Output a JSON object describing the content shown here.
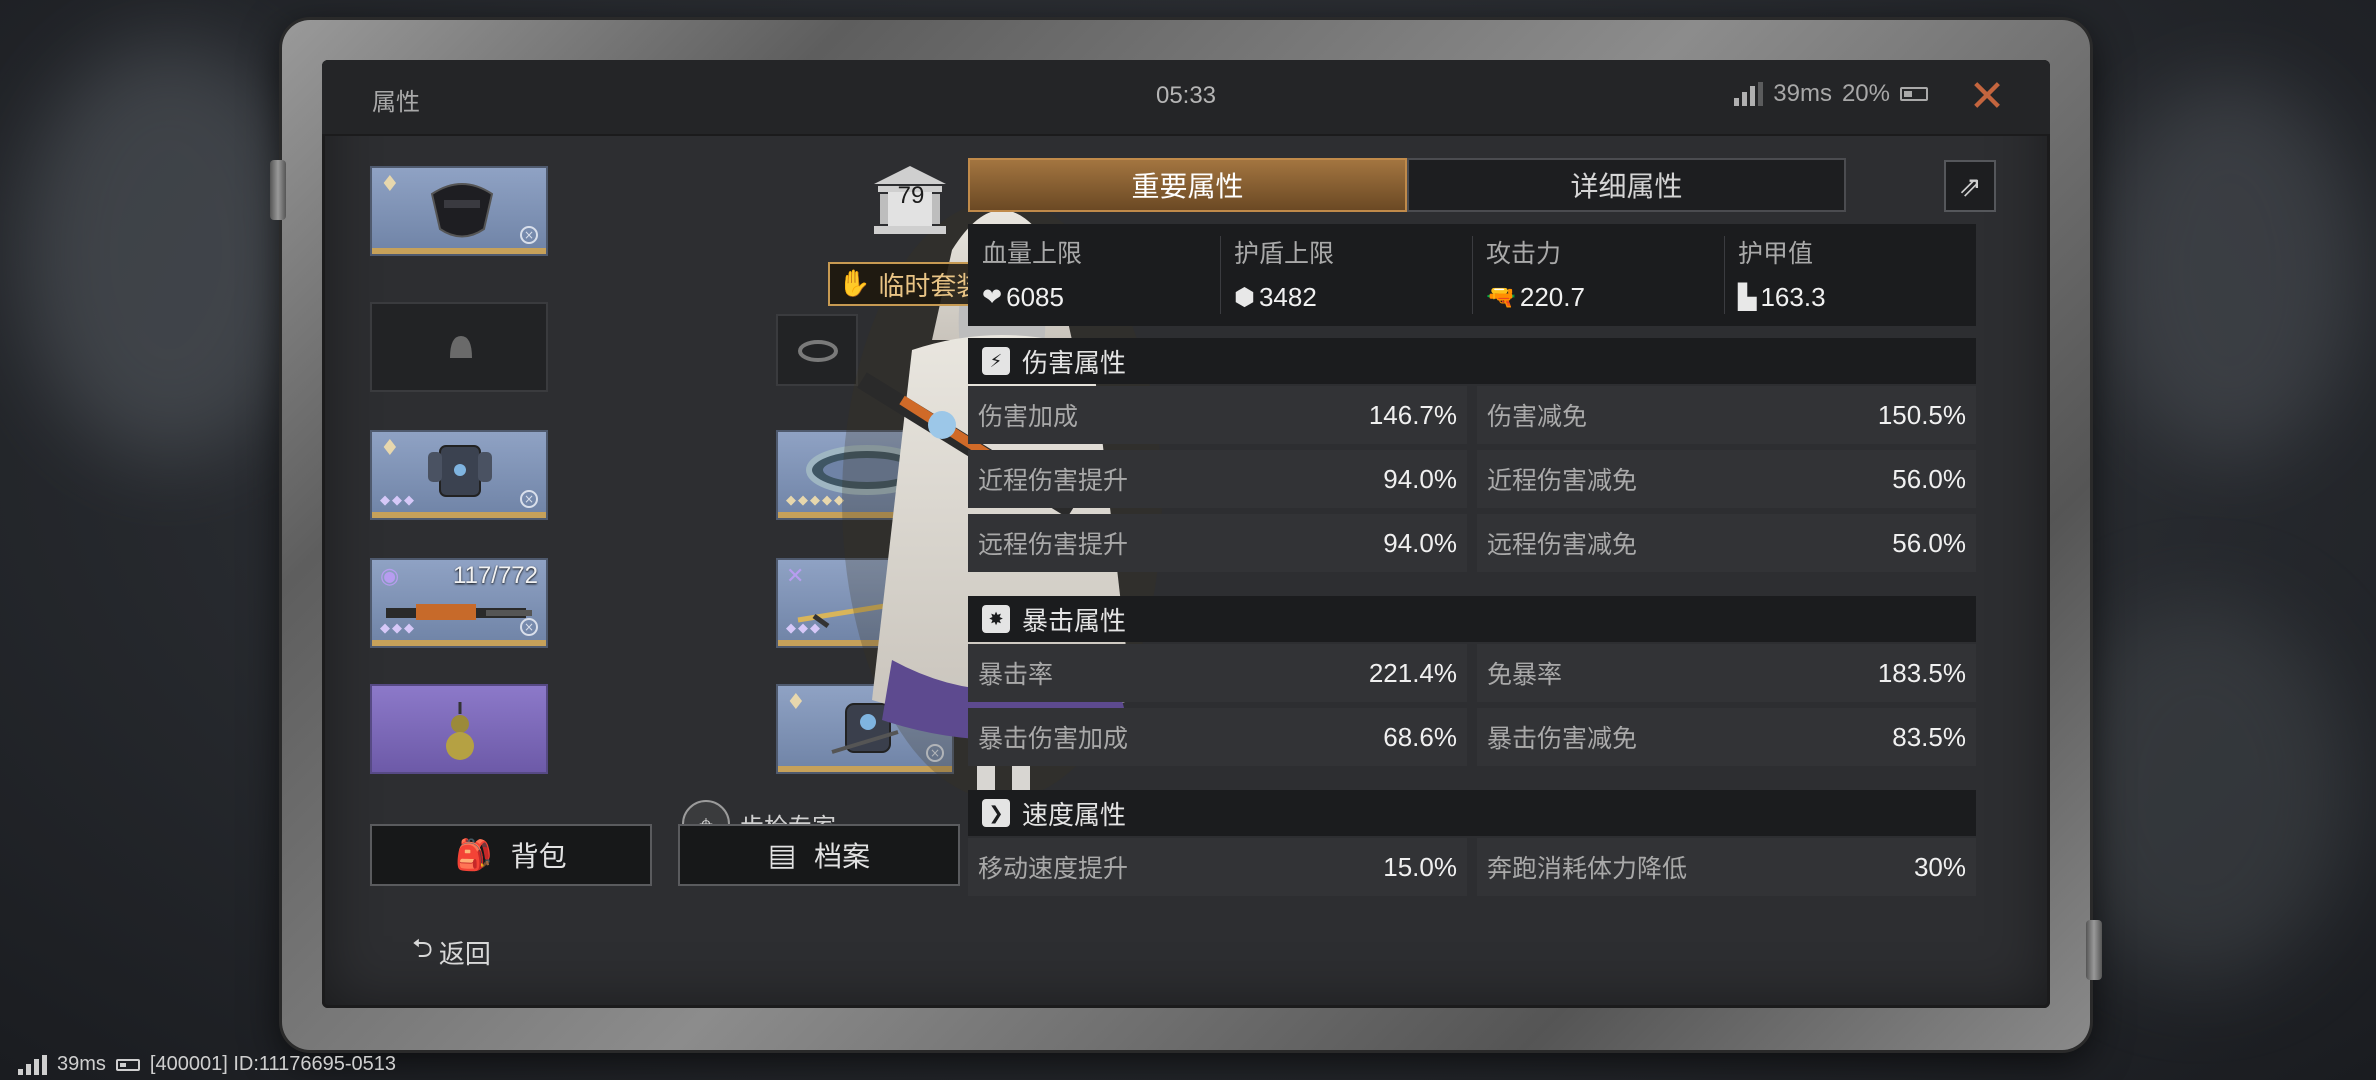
{
  "window": {
    "title": "属性",
    "time": "05:33",
    "ping": "39ms",
    "battery": "20%"
  },
  "character": {
    "level": "79",
    "set_label": "临时套装",
    "specialty": "步枪专家",
    "weapon_ammo": "117/772"
  },
  "buttons": {
    "backpack": "背包",
    "archive": "档案",
    "back": "返回"
  },
  "tabs": {
    "main": "重要属性",
    "detail": "详细属性"
  },
  "key_stats": [
    {
      "label": "血量上限",
      "value": "6085",
      "icon": "heart-icon"
    },
    {
      "label": "护盾上限",
      "value": "3482",
      "icon": "shield-icon"
    },
    {
      "label": "攻击力",
      "value": "220.7",
      "icon": "gun-icon"
    },
    {
      "label": "护甲值",
      "value": "163.3",
      "icon": "armor-icon"
    }
  ],
  "sections": {
    "damage": {
      "title": "伤害属性",
      "rows": [
        [
          {
            "label": "伤害加成",
            "value": "146.7%"
          },
          {
            "label": "伤害减免",
            "value": "150.5%"
          }
        ],
        [
          {
            "label": "近程伤害提升",
            "value": "94.0%"
          },
          {
            "label": "近程伤害减免",
            "value": "56.0%"
          }
        ],
        [
          {
            "label": "远程伤害提升",
            "value": "94.0%"
          },
          {
            "label": "远程伤害减免",
            "value": "56.0%"
          }
        ]
      ]
    },
    "crit": {
      "title": "暴击属性",
      "rows": [
        [
          {
            "label": "暴击率",
            "value": "221.4%"
          },
          {
            "label": "免暴率",
            "value": "183.5%"
          }
        ],
        [
          {
            "label": "暴击伤害加成",
            "value": "68.6%"
          },
          {
            "label": "暴击伤害减免",
            "value": "83.5%"
          }
        ]
      ]
    },
    "speed": {
      "title": "速度属性",
      "rows": [
        [
          {
            "label": "移动速度提升",
            "value": "15.0%"
          },
          {
            "label": "奔跑消耗体力降低",
            "value": "30%"
          }
        ]
      ]
    }
  },
  "footer": {
    "ping": "39ms",
    "id_text": "[400001] ID:11176695-0513"
  },
  "colors": {
    "accent_gold": "#c08a4a",
    "close": "#c4653e",
    "slot_blue": "#7f93b6",
    "slot_purple": "#7d69b8"
  }
}
